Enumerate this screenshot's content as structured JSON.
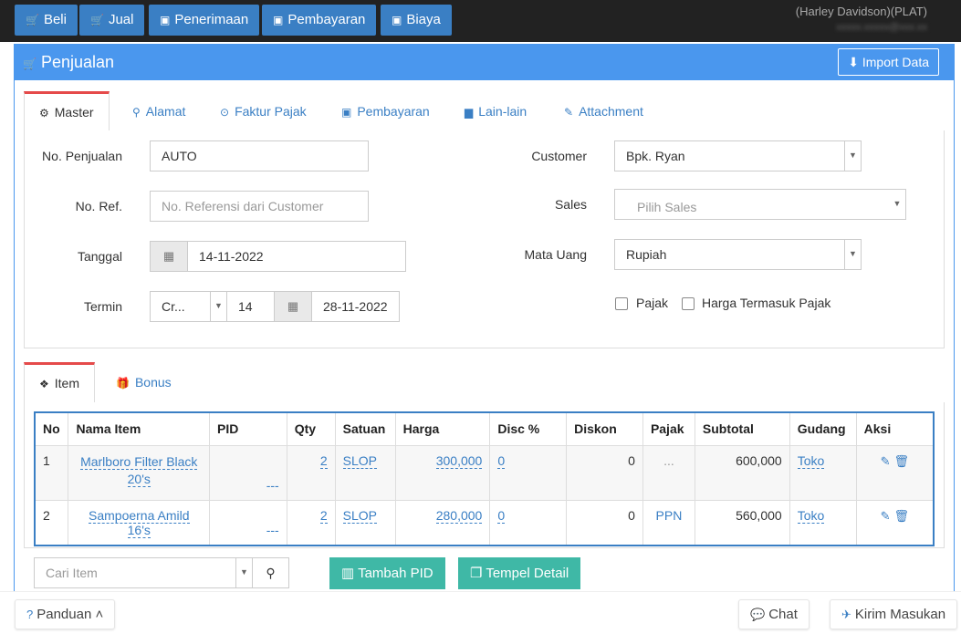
{
  "topbar": {
    "buttons": [
      {
        "icon": "cart-icon",
        "glyph": "🛒",
        "label": "Beli"
      },
      {
        "icon": "cart-icon",
        "glyph": "🛒",
        "label": "Jual"
      },
      {
        "icon": "money-icon",
        "glyph": "▣",
        "label": "Penerimaan"
      },
      {
        "icon": "money-icon",
        "glyph": "▣",
        "label": "Pembayaran"
      },
      {
        "icon": "money-icon",
        "glyph": "▣",
        "label": "Biaya"
      }
    ],
    "company": "(Harley Davidson)(PLAT)",
    "email": "xxxxx.xxxxx@xxx.xx"
  },
  "panel": {
    "title": "Penjualan",
    "import_label": "Import Data"
  },
  "tabs": [
    {
      "label": "Master",
      "glyph": "⚙"
    },
    {
      "label": "Alamat",
      "glyph": "⚲"
    },
    {
      "label": "Faktur Pajak",
      "glyph": "⊙"
    },
    {
      "label": "Pembayaran",
      "glyph": "▣"
    },
    {
      "label": "Lain-lain",
      "glyph": "▆"
    },
    {
      "label": "Attachment",
      "glyph": "✎"
    }
  ],
  "form": {
    "no_penjualan_label": "No. Penjualan",
    "no_penjualan_value": "AUTO",
    "no_ref_label": "No. Ref.",
    "no_ref_placeholder": "No. Referensi dari Customer",
    "tanggal_label": "Tanggal",
    "tanggal_value": "14-11-2022",
    "termin_label": "Termin",
    "termin_type": "Cr...",
    "termin_days": "14",
    "termin_date": "28-11-2022",
    "customer_label": "Customer",
    "customer_value": "Bpk. Ryan",
    "sales_label": "Sales",
    "sales_placeholder": "Pilih Sales",
    "mata_uang_label": "Mata Uang",
    "mata_uang_value": "Rupiah",
    "pajak_label": "Pajak",
    "harga_termasuk_label": "Harga Termasuk Pajak"
  },
  "subtabs": [
    {
      "label": "Item",
      "glyph": "❖"
    },
    {
      "label": "Bonus",
      "glyph": "🎁"
    }
  ],
  "table": {
    "headers": [
      "No",
      "Nama Item",
      "PID",
      "Qty",
      "Satuan",
      "Harga",
      "Disc %",
      "Diskon",
      "Pajak",
      "Subtotal",
      "Gudang",
      "Aksi"
    ],
    "rows": [
      {
        "no": "1",
        "nama": "Marlboro Filter Black 20's",
        "pid": "---",
        "qty": "2",
        "satuan": "SLOP",
        "harga": "300,000",
        "disc": "0",
        "diskon": "0",
        "pajak": "...",
        "subtotal": "600,000",
        "gudang": "Toko"
      },
      {
        "no": "2",
        "nama": "Sampoerna Amild 16's",
        "pid": "---",
        "qty": "2",
        "satuan": "SLOP",
        "harga": "280,000",
        "disc": "0",
        "diskon": "0",
        "pajak": "PPN",
        "subtotal": "560,000",
        "gudang": "Toko"
      }
    ]
  },
  "actions": {
    "search_placeholder": "Cari Item",
    "tambah_pid": "Tambah PID",
    "tempel_detail": "Tempel Detail"
  },
  "footer": {
    "panduan": "Panduan",
    "chat": "Chat",
    "kirim": "Kirim Masukan"
  },
  "colors": {
    "primary": "#3a7fc4",
    "header": "#4a97ee",
    "topbar": "#222222",
    "green": "#3fb8a6",
    "active_tab": "#e54a4a"
  }
}
